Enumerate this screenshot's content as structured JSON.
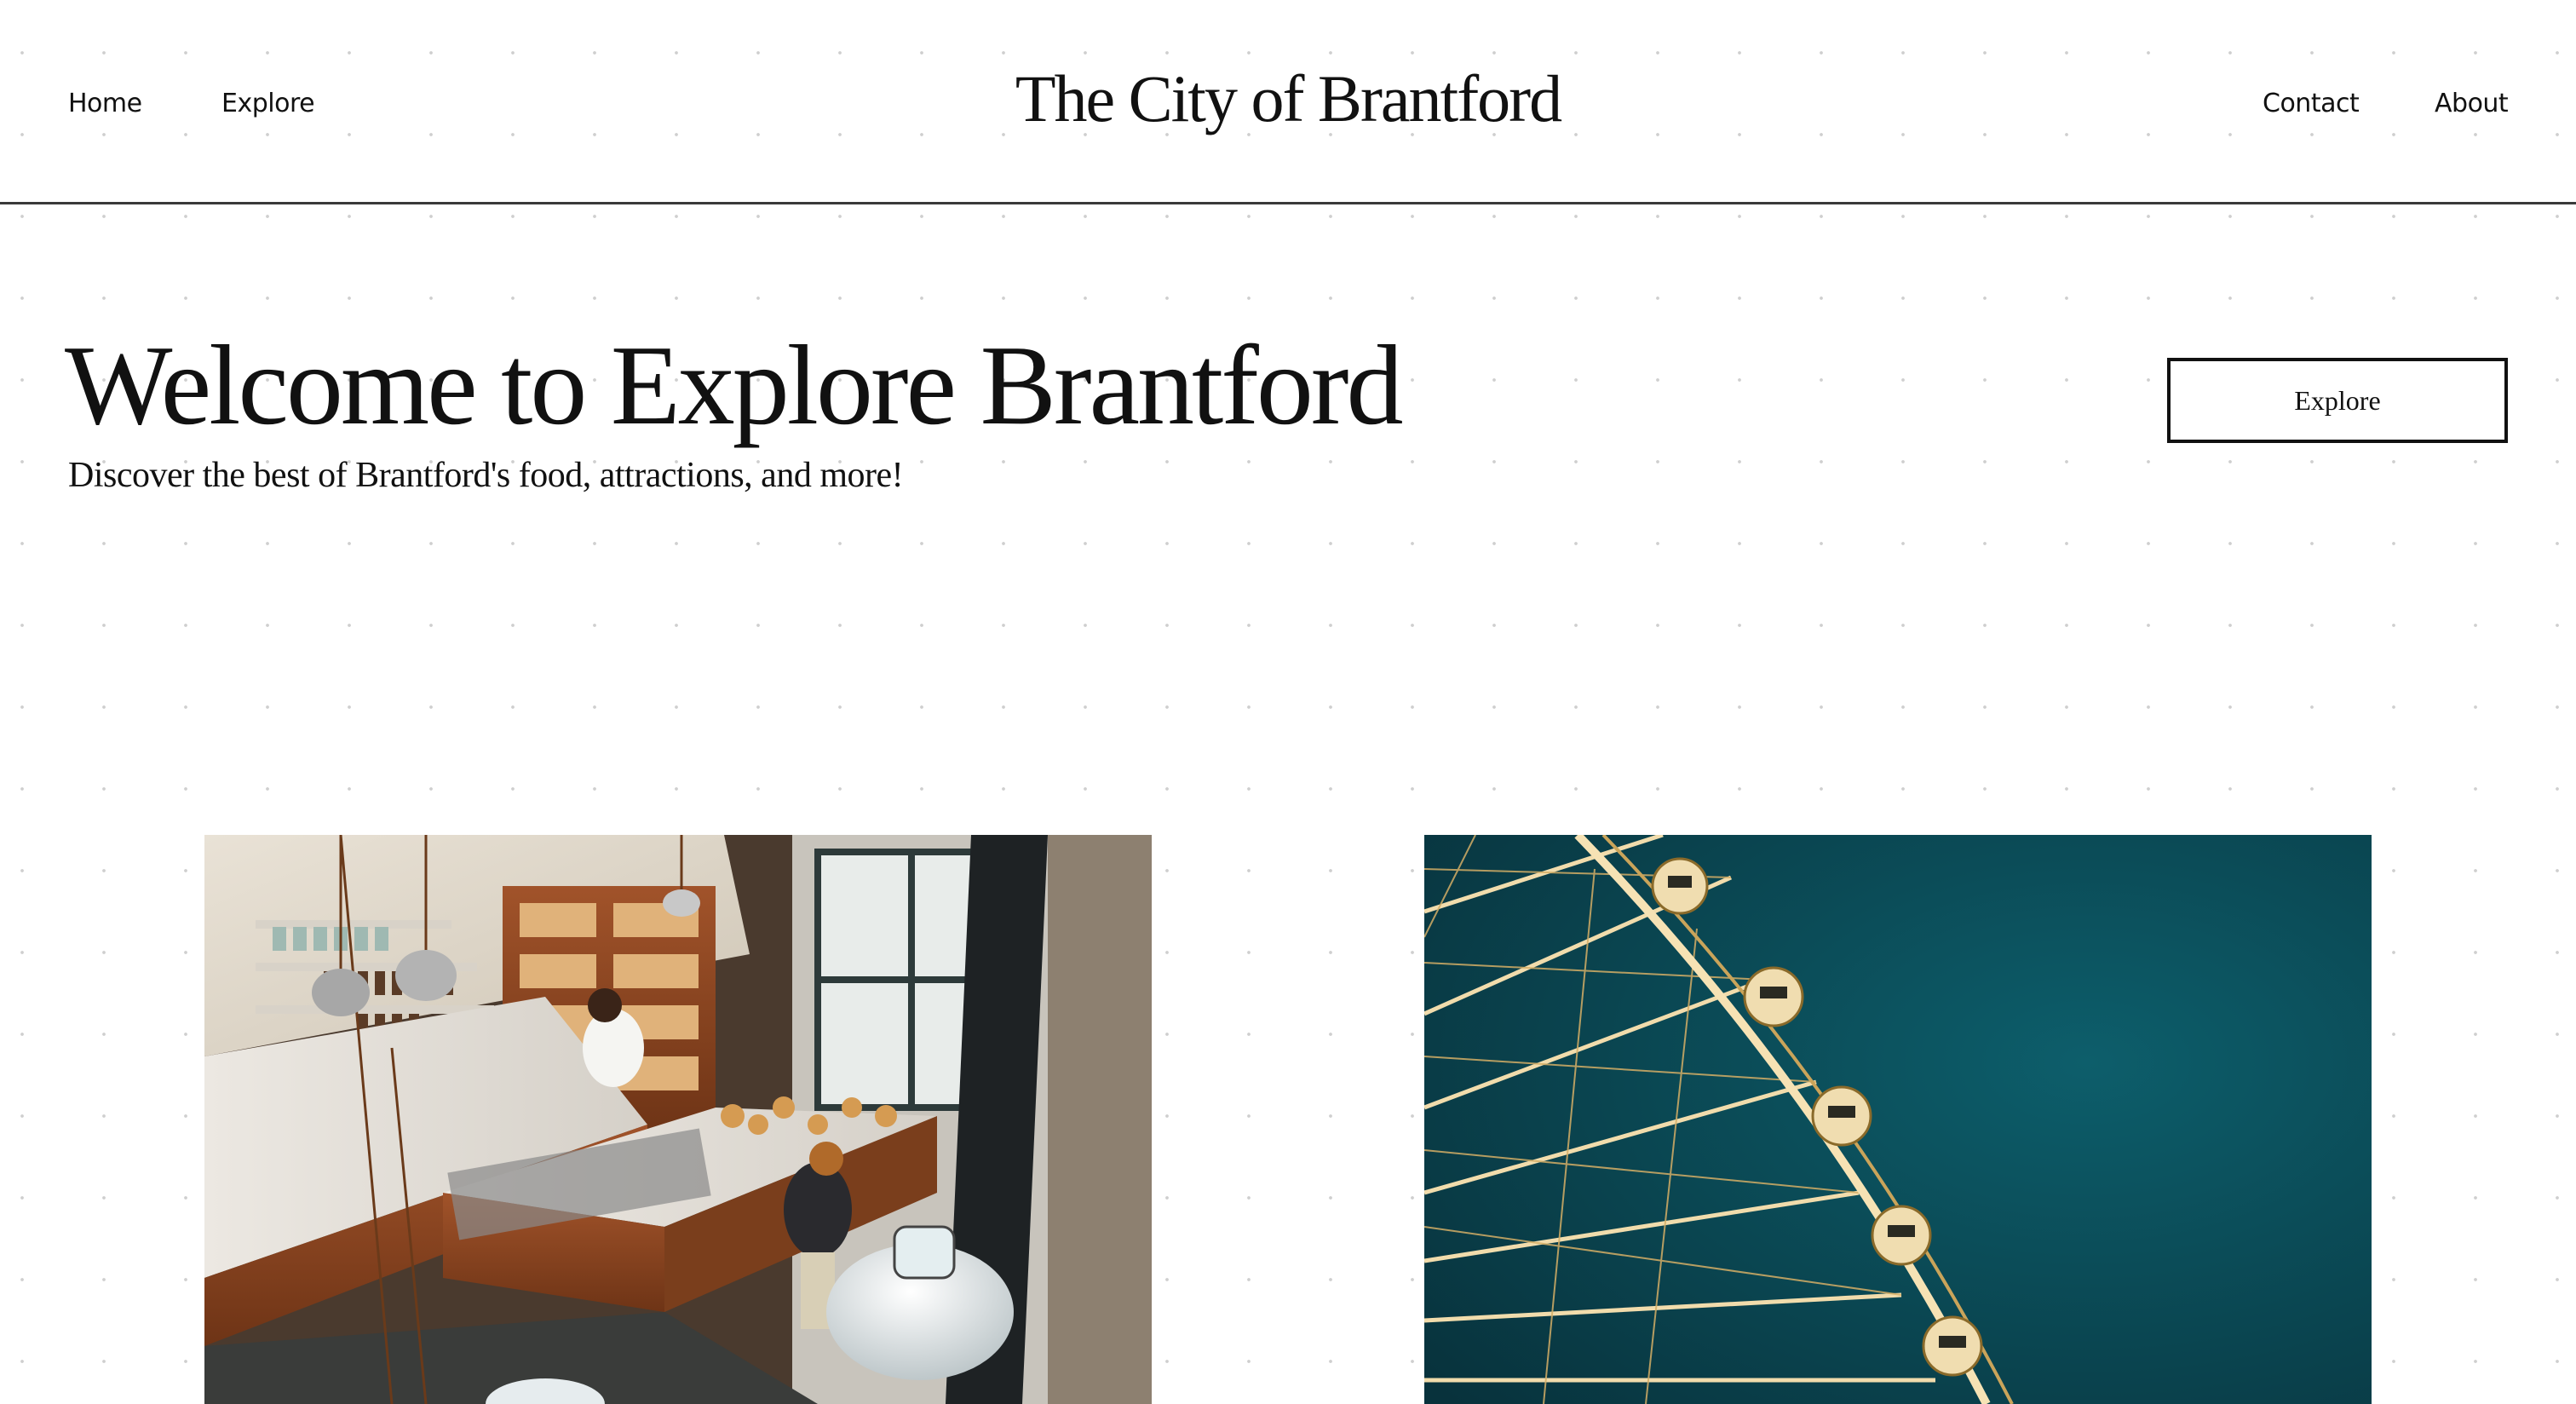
{
  "header": {
    "site_title": "The City of Brantford",
    "nav_left": [
      {
        "label": "Home"
      },
      {
        "label": "Explore"
      }
    ],
    "nav_right": [
      {
        "label": "Contact"
      },
      {
        "label": "About"
      }
    ]
  },
  "hero": {
    "title": "Welcome to Explore Brantford",
    "subtitle": "Discover the best of Brantford's food, attractions, and more!",
    "button_label": "Explore"
  },
  "gallery": {
    "images": [
      {
        "subject": "bakery-cafe-interior"
      },
      {
        "subject": "ferris-wheel-night"
      }
    ]
  },
  "colors": {
    "text": "#111111",
    "background": "#ffffff",
    "divider": "#3a3a3a",
    "sky_teal": "#0e5a66",
    "ferris_gold": "#e8c98a"
  }
}
